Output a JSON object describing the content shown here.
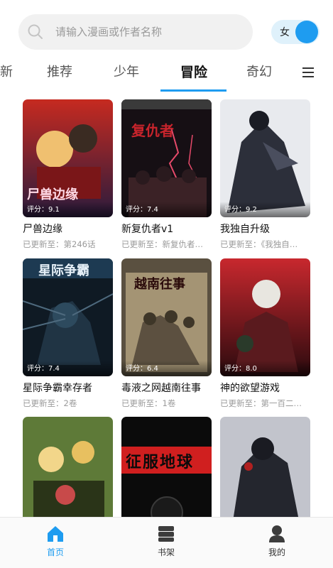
{
  "search": {
    "placeholder": "请输入漫画或作者名称"
  },
  "gender_toggle": {
    "label": "女"
  },
  "tabs": [
    {
      "label": "新"
    },
    {
      "label": "推荐"
    },
    {
      "label": "少年"
    },
    {
      "label": "冒险",
      "active": true
    },
    {
      "label": "奇幻"
    }
  ],
  "comics": [
    {
      "title": "尸兽边缘",
      "rating": "评分：9.1",
      "update": "已更新至：第246话",
      "cover_text": "尸兽边缘",
      "colors": [
        "#b3161c",
        "#2a1b3d"
      ]
    },
    {
      "title": "新复仇者v1",
      "rating": "评分：7.4",
      "update": "已更新至：新复仇者…",
      "cover_text": "复仇者",
      "colors": [
        "#1a1218",
        "#6b1f2a"
      ]
    },
    {
      "title": "我独自升级",
      "rating": "评分：9.2",
      "update": "已更新至：《我独自…",
      "cover_text": "",
      "colors": [
        "#e9ecef",
        "#2c2f3a"
      ]
    },
    {
      "title": "星际争霸幸存者",
      "rating": "评分：7.4",
      "update": "已更新至：2卷",
      "cover_text": "星际争霸",
      "colors": [
        "#1d3a52",
        "#0d1620"
      ]
    },
    {
      "title": "毒液之网越南往事",
      "rating": "评分：6.4",
      "update": "已更新至：1卷",
      "cover_text": "越南往事",
      "colors": [
        "#8c7b5c",
        "#3a3226"
      ]
    },
    {
      "title": "神的欲望游戏",
      "rating": "评分：8.0",
      "update": "已更新至：第一百二…",
      "cover_text": "",
      "colors": [
        "#c0232c",
        "#2a0a0e"
      ]
    },
    {
      "title": "",
      "rating": "",
      "update": "",
      "cover_text": "",
      "colors": [
        "#6a7d3a",
        "#1f2a14"
      ]
    },
    {
      "title": "",
      "rating": "",
      "update": "",
      "cover_text": "征服地球",
      "colors": [
        "#d01f1f",
        "#0b0b0b"
      ]
    },
    {
      "title": "",
      "rating": "",
      "update": "",
      "cover_text": "",
      "colors": [
        "#b9bcc4",
        "#24262e"
      ]
    }
  ],
  "bottom_nav": [
    {
      "label": "首页",
      "icon": "home-icon",
      "active": true
    },
    {
      "label": "书架",
      "icon": "bookshelf-icon",
      "active": false
    },
    {
      "label": "我的",
      "icon": "profile-icon",
      "active": false
    }
  ],
  "colors": {
    "accent": "#1e9cf0",
    "muted": "#9a9a9a"
  }
}
